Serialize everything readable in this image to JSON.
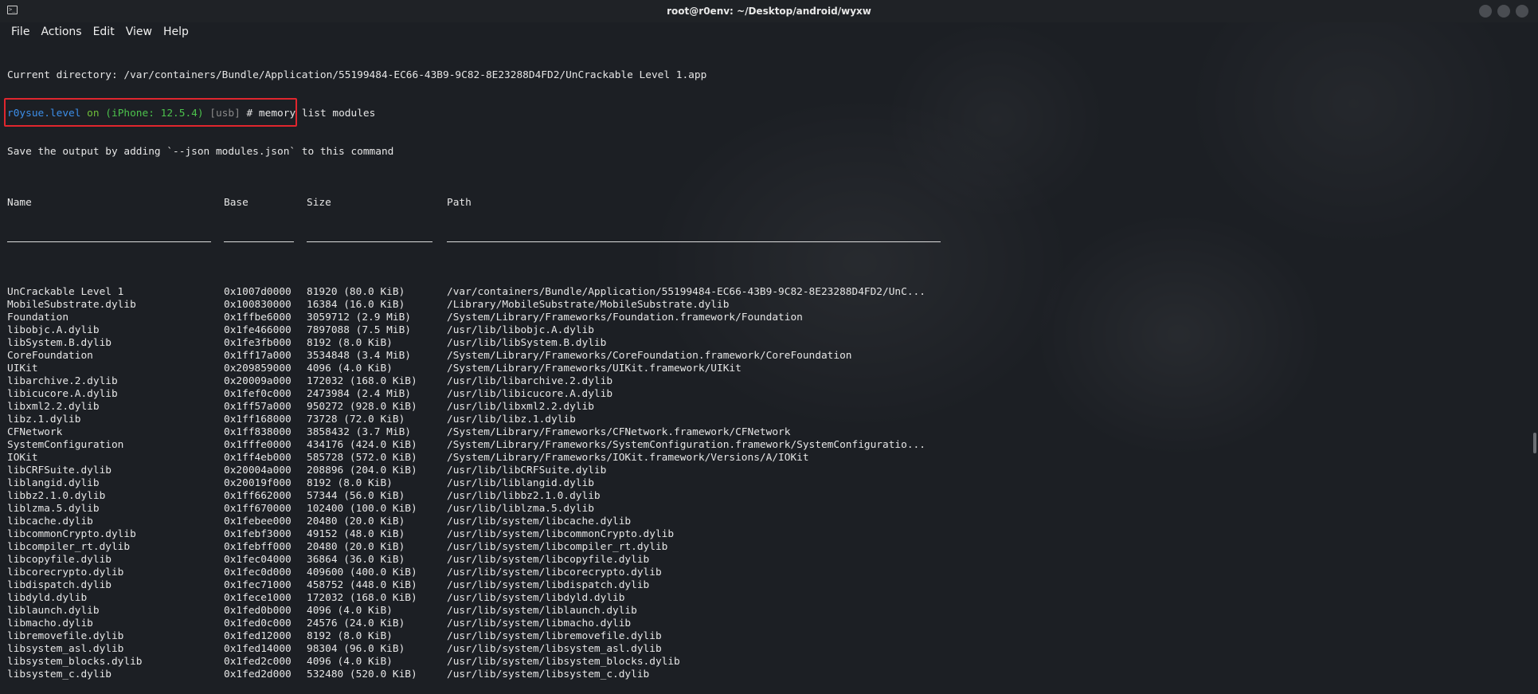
{
  "window": {
    "title": "root@r0env: ~/Desktop/android/wyxw"
  },
  "menu": [
    "File",
    "Actions",
    "Edit",
    "View",
    "Help"
  ],
  "terminal": {
    "cwd_line": "Current directory: /var/containers/Bundle/Application/55199484-EC66-43B9-9C82-8E23288D4FD2/UnCrackable Level 1.app",
    "prompt": {
      "user": "r0ysue.level",
      "on": " on ",
      "device": "(iPhone: 12.5.4)",
      "conn": " [usb]",
      "sep": " # ",
      "command": "memory list modules"
    },
    "hint": "Save the output by adding `--json modules.json` to this command"
  },
  "table": {
    "headers": {
      "name": "Name",
      "base": "Base",
      "size": "Size",
      "path": "Path"
    },
    "rows": [
      [
        "UnCrackable Level 1",
        "0x1007d0000",
        "81920 (80.0 KiB)",
        "/var/containers/Bundle/Application/55199484-EC66-43B9-9C82-8E23288D4FD2/UnC..."
      ],
      [
        "MobileSubstrate.dylib",
        "0x100830000",
        "16384 (16.0 KiB)",
        "/Library/MobileSubstrate/MobileSubstrate.dylib"
      ],
      [
        "Foundation",
        "0x1ffbe6000",
        "3059712 (2.9 MiB)",
        "/System/Library/Frameworks/Foundation.framework/Foundation"
      ],
      [
        "libobjc.A.dylib",
        "0x1fe466000",
        "7897088 (7.5 MiB)",
        "/usr/lib/libobjc.A.dylib"
      ],
      [
        "libSystem.B.dylib",
        "0x1fe3fb000",
        "8192 (8.0 KiB)",
        "/usr/lib/libSystem.B.dylib"
      ],
      [
        "CoreFoundation",
        "0x1ff17a000",
        "3534848 (3.4 MiB)",
        "/System/Library/Frameworks/CoreFoundation.framework/CoreFoundation"
      ],
      [
        "UIKit",
        "0x209859000",
        "4096 (4.0 KiB)",
        "/System/Library/Frameworks/UIKit.framework/UIKit"
      ],
      [
        "libarchive.2.dylib",
        "0x20009a000",
        "172032 (168.0 KiB)",
        "/usr/lib/libarchive.2.dylib"
      ],
      [
        "libicucore.A.dylib",
        "0x1fef0c000",
        "2473984 (2.4 MiB)",
        "/usr/lib/libicucore.A.dylib"
      ],
      [
        "libxml2.2.dylib",
        "0x1ff57a000",
        "950272 (928.0 KiB)",
        "/usr/lib/libxml2.2.dylib"
      ],
      [
        "libz.1.dylib",
        "0x1ff168000",
        "73728 (72.0 KiB)",
        "/usr/lib/libz.1.dylib"
      ],
      [
        "CFNetwork",
        "0x1ff838000",
        "3858432 (3.7 MiB)",
        "/System/Library/Frameworks/CFNetwork.framework/CFNetwork"
      ],
      [
        "SystemConfiguration",
        "0x1fffe0000",
        "434176 (424.0 KiB)",
        "/System/Library/Frameworks/SystemConfiguration.framework/SystemConfiguratio..."
      ],
      [
        "IOKit",
        "0x1ff4eb000",
        "585728 (572.0 KiB)",
        "/System/Library/Frameworks/IOKit.framework/Versions/A/IOKit"
      ],
      [
        "libCRFSuite.dylib",
        "0x20004a000",
        "208896 (204.0 KiB)",
        "/usr/lib/libCRFSuite.dylib"
      ],
      [
        "liblangid.dylib",
        "0x20019f000",
        "8192 (8.0 KiB)",
        "/usr/lib/liblangid.dylib"
      ],
      [
        "libbz2.1.0.dylib",
        "0x1ff662000",
        "57344 (56.0 KiB)",
        "/usr/lib/libbz2.1.0.dylib"
      ],
      [
        "liblzma.5.dylib",
        "0x1ff670000",
        "102400 (100.0 KiB)",
        "/usr/lib/liblzma.5.dylib"
      ],
      [
        "libcache.dylib",
        "0x1febee000",
        "20480 (20.0 KiB)",
        "/usr/lib/system/libcache.dylib"
      ],
      [
        "libcommonCrypto.dylib",
        "0x1febf3000",
        "49152 (48.0 KiB)",
        "/usr/lib/system/libcommonCrypto.dylib"
      ],
      [
        "libcompiler_rt.dylib",
        "0x1febff000",
        "20480 (20.0 KiB)",
        "/usr/lib/system/libcompiler_rt.dylib"
      ],
      [
        "libcopyfile.dylib",
        "0x1fec04000",
        "36864 (36.0 KiB)",
        "/usr/lib/system/libcopyfile.dylib"
      ],
      [
        "libcorecrypto.dylib",
        "0x1fec0d000",
        "409600 (400.0 KiB)",
        "/usr/lib/system/libcorecrypto.dylib"
      ],
      [
        "libdispatch.dylib",
        "0x1fec71000",
        "458752 (448.0 KiB)",
        "/usr/lib/system/libdispatch.dylib"
      ],
      [
        "libdyld.dylib",
        "0x1fece1000",
        "172032 (168.0 KiB)",
        "/usr/lib/system/libdyld.dylib"
      ],
      [
        "liblaunch.dylib",
        "0x1fed0b000",
        "4096 (4.0 KiB)",
        "/usr/lib/system/liblaunch.dylib"
      ],
      [
        "libmacho.dylib",
        "0x1fed0c000",
        "24576 (24.0 KiB)",
        "/usr/lib/system/libmacho.dylib"
      ],
      [
        "libremovefile.dylib",
        "0x1fed12000",
        "8192 (8.0 KiB)",
        "/usr/lib/system/libremovefile.dylib"
      ],
      [
        "libsystem_asl.dylib",
        "0x1fed14000",
        "98304 (96.0 KiB)",
        "/usr/lib/system/libsystem_asl.dylib"
      ],
      [
        "libsystem_blocks.dylib",
        "0x1fed2c000",
        "4096 (4.0 KiB)",
        "/usr/lib/system/libsystem_blocks.dylib"
      ],
      [
        "libsystem_c.dylib",
        "0x1fed2d000",
        "532480 (520.0 KiB)",
        "/usr/lib/system/libsystem_c.dylib"
      ]
    ]
  }
}
